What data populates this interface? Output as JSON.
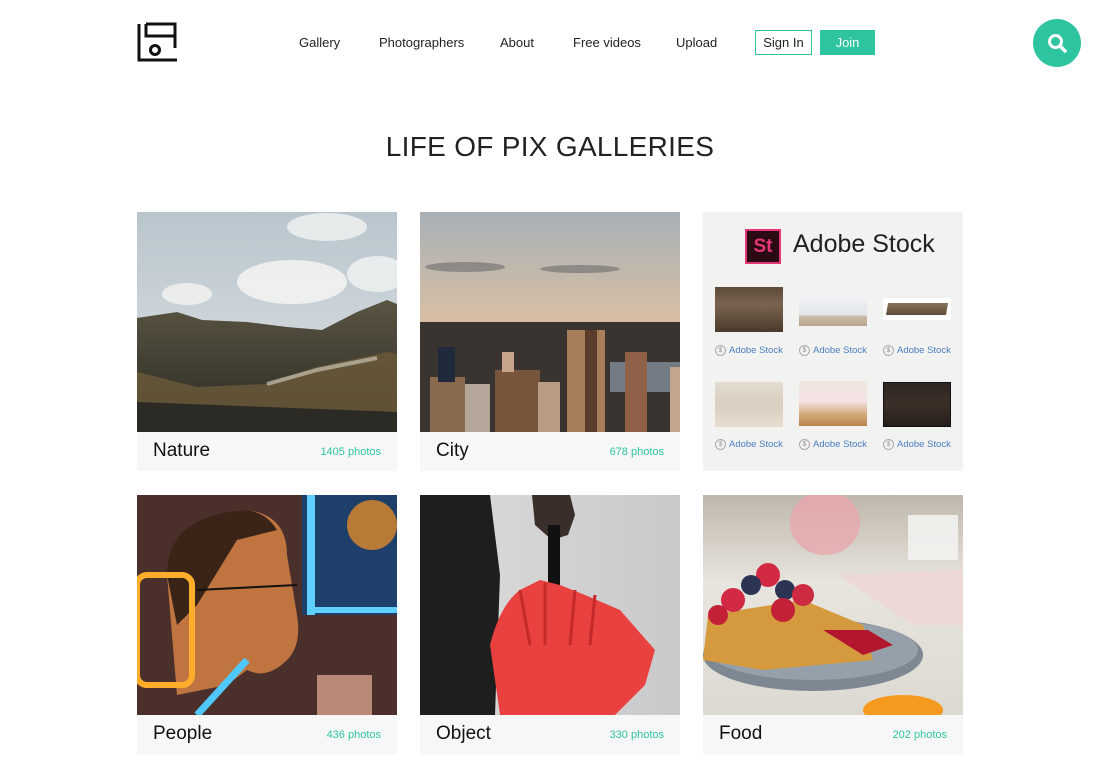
{
  "header": {
    "logo": "life-of-pix-logo",
    "nav": [
      {
        "label": "Gallery"
      },
      {
        "label": "Photographers"
      },
      {
        "label": "About"
      },
      {
        "label": "Free videos"
      },
      {
        "label": "Upload"
      }
    ],
    "sign_in_label": "Sign In",
    "join_label": "Join",
    "search_icon": "search-icon"
  },
  "colors": {
    "accent": "#2ec4a0",
    "adobe_pink": "#e5367a",
    "adobe_dark": "#2b0a13",
    "link_blue": "#4a7ec0"
  },
  "main": {
    "title": "LIFE OF PIX GALLERIES",
    "galleries": [
      {
        "name": "Nature",
        "count": "1405 photos",
        "image": "mountains landscape"
      },
      {
        "name": "City",
        "count": "678 photos",
        "image": "city skyline at sunset"
      },
      {
        "name": "People",
        "count": "436 photos",
        "image": "man with glasses in neon light"
      },
      {
        "name": "Object",
        "count": "330 photos",
        "image": "red umbrella held in hand"
      },
      {
        "name": "Food",
        "count": "202 photos",
        "image": "french toast with berries"
      }
    ],
    "adobe_stock": {
      "logo_text": "St",
      "name": "Adobe Stock",
      "items": [
        {
          "label": "Adobe Stock",
          "image": "dark wood texture"
        },
        {
          "label": "Adobe Stock",
          "image": "blurred white tabletop"
        },
        {
          "label": "Adobe Stock",
          "image": "wooden table top"
        },
        {
          "label": "Adobe Stock",
          "image": "light wood texture"
        },
        {
          "label": "Adobe Stock",
          "image": "kitchen counter blurred"
        },
        {
          "label": "Adobe Stock",
          "image": "dark wood planks"
        }
      ]
    }
  }
}
